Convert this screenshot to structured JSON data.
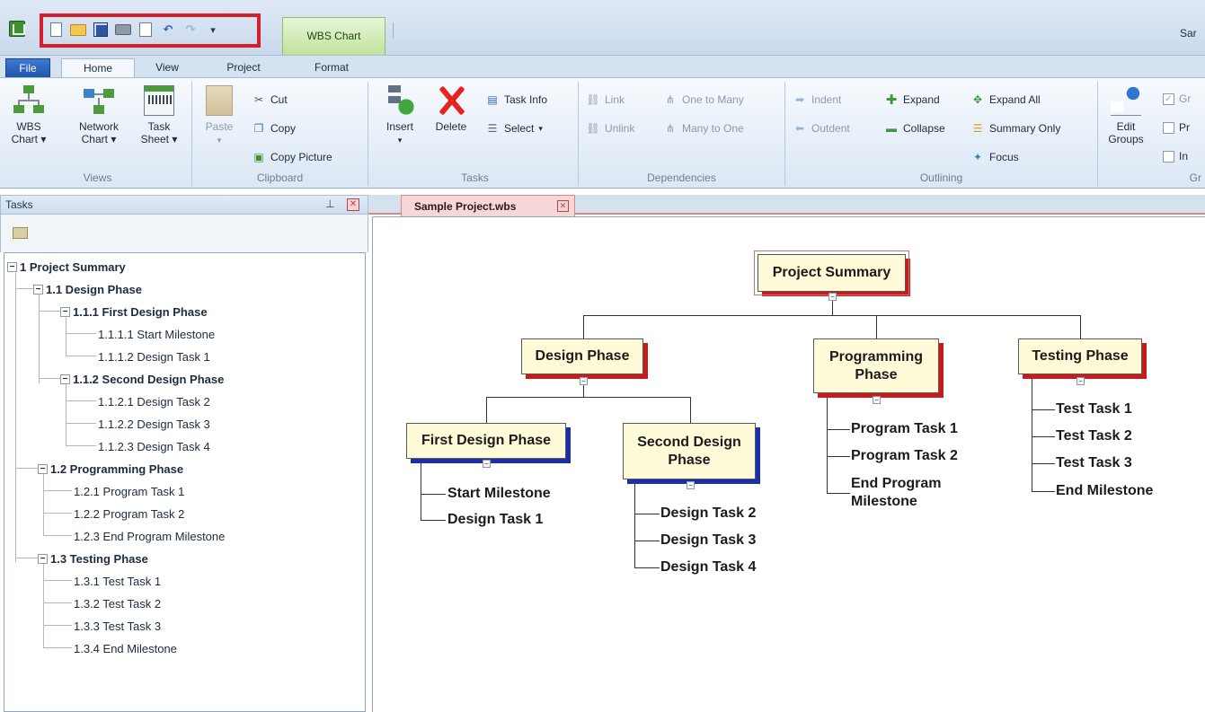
{
  "title_bar": {
    "context_tab": "WBS Chart",
    "document_title": "Sar"
  },
  "ribbon_tabs": [
    "File",
    "Home",
    "View",
    "Project",
    "Format"
  ],
  "ribbon": {
    "views": {
      "label": "Views",
      "wbs_chart": "WBS\nChart ▾",
      "network_chart": "Network\nChart ▾",
      "task_sheet": "Task\nSheet ▾"
    },
    "clipboard": {
      "label": "Clipboard",
      "paste": "Paste",
      "cut": "Cut",
      "copy": "Copy",
      "copy_picture": "Copy Picture"
    },
    "tasks": {
      "label": "Tasks",
      "insert": "Insert",
      "delete": "Delete",
      "task_info": "Task Info",
      "select": "Select"
    },
    "dependencies": {
      "label": "Dependencies",
      "link": "Link",
      "unlink": "Unlink",
      "one_to_many": "One to Many",
      "many_to_one": "Many to One"
    },
    "outlining": {
      "label": "Outlining",
      "indent": "Indent",
      "outdent": "Outdent",
      "expand": "Expand",
      "collapse": "Collapse",
      "expand_all": "Expand All",
      "summary_only": "Summary Only",
      "focus": "Focus"
    },
    "groups": {
      "label": "Gr",
      "edit_groups": "Edit\nGroups",
      "check1": "Gr",
      "check2": "Pr",
      "check3": "In"
    }
  },
  "tasks_pane": {
    "title": "Tasks",
    "tree": [
      "1 Project Summary",
      "1.1 Design Phase",
      "1.1.1 First Design Phase",
      "1.1.1.1 Start Milestone",
      "1.1.1.2 Design Task 1",
      "1.1.2 Second Design Phase",
      "1.1.2.1 Design Task 2",
      "1.1.2.2 Design Task 3",
      "1.1.2.3 Design Task 4",
      "1.2 Programming Phase",
      "1.2.1 Program Task 1",
      "1.2.2 Program Task 2",
      "1.2.3 End Program Milestone",
      "1.3 Testing Phase",
      "1.3.1 Test Task 1",
      "1.3.2 Test Task 2",
      "1.3.3 Test Task 3",
      "1.3.4 End Milestone"
    ]
  },
  "document_tab": "Sample Project.wbs",
  "wbs": {
    "root": "Project Summary",
    "phases": [
      "Design Phase",
      "Programming Phase",
      "Testing Phase"
    ],
    "subphases": [
      "First Design Phase",
      "Second Design Phase"
    ],
    "first_design_tasks": [
      "Start Milestone",
      "Design Task 1"
    ],
    "second_design_tasks": [
      "Design Task 2",
      "Design Task 3",
      "Design Task 4"
    ],
    "programming_tasks": [
      "Program Task 1",
      "Program Task 2",
      "End Program Milestone"
    ],
    "testing_tasks": [
      "Test Task 1",
      "Test Task 2",
      "Test Task 3",
      "End Milestone"
    ]
  },
  "colors": {
    "phase_shadow": "#c81b1b",
    "subphase_shadow": "#1c2fa8",
    "box_fill": "#fffbd8",
    "highlight_frame": "#d51f2b"
  }
}
